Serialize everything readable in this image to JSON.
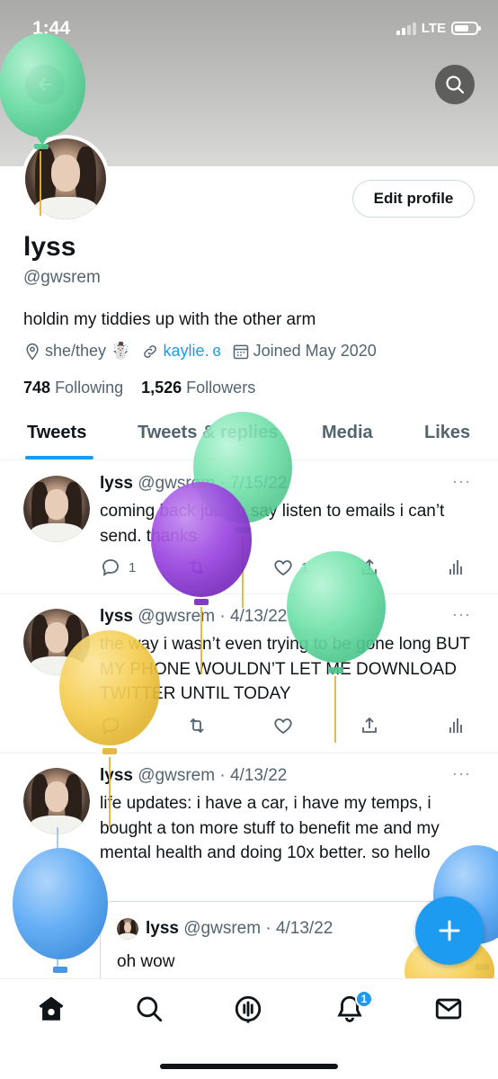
{
  "status": {
    "time": "1:44",
    "network": "LTE"
  },
  "profile": {
    "name": "lyss",
    "handle": "@gwsrem",
    "bio": "holdin my tiddies up with the other arm",
    "pronouns": "she/they ☃️",
    "link": "kaylie.",
    "joined": "Joined May 2020",
    "following_count": "748",
    "following_label": "Following",
    "followers_count": "1,526",
    "followers_label": "Followers",
    "edit_label": "Edit profile"
  },
  "tabs": [
    "Tweets",
    "Tweets & replies",
    "Media",
    "Likes"
  ],
  "tweets": [
    {
      "name": "lyss",
      "handle": "@gwsrem",
      "date": "· 7/15/22",
      "text": "coming back just to say listen to emails i can’t send. thanks",
      "replies": "1",
      "likes": "1"
    },
    {
      "name": "lyss",
      "handle": "@gwsrem",
      "date": "· 4/13/22",
      "text": "the way i wasn’t even trying to be gone long BUT MY PHONE WOULDN’T LET ME DOWNLOAD TWITTER UNTIL TODAY"
    },
    {
      "name": "lyss",
      "handle": "@gwsrem",
      "date": "· 4/13/22",
      "text": "life updates: i have a car, i have my temps, i bought a ton more stuff to benefit me and my mental health and doing 10x better. so hello",
      "quote": {
        "name": "lyss",
        "handle": "@gwsrem",
        "date": "· 4/13/22",
        "text": "oh wow"
      }
    }
  ],
  "nav": {
    "notification_badge": "1"
  },
  "colors": {
    "accent": "#1d9bf0",
    "green_balloon": "#6ee0a8",
    "purple_balloon": "#9b45e0",
    "yellow_balloon": "#f5cd4f",
    "blue_balloon": "#5aa9f5"
  },
  "icons": [
    "back-arrow-icon",
    "search-icon",
    "location-icon",
    "link-icon",
    "calendar-icon",
    "reply-icon",
    "retweet-icon",
    "like-icon",
    "share-icon",
    "analytics-icon",
    "more-icon",
    "compose-plus-icon",
    "home-icon",
    "explore-icon",
    "spaces-icon",
    "notifications-icon",
    "messages-icon"
  ]
}
